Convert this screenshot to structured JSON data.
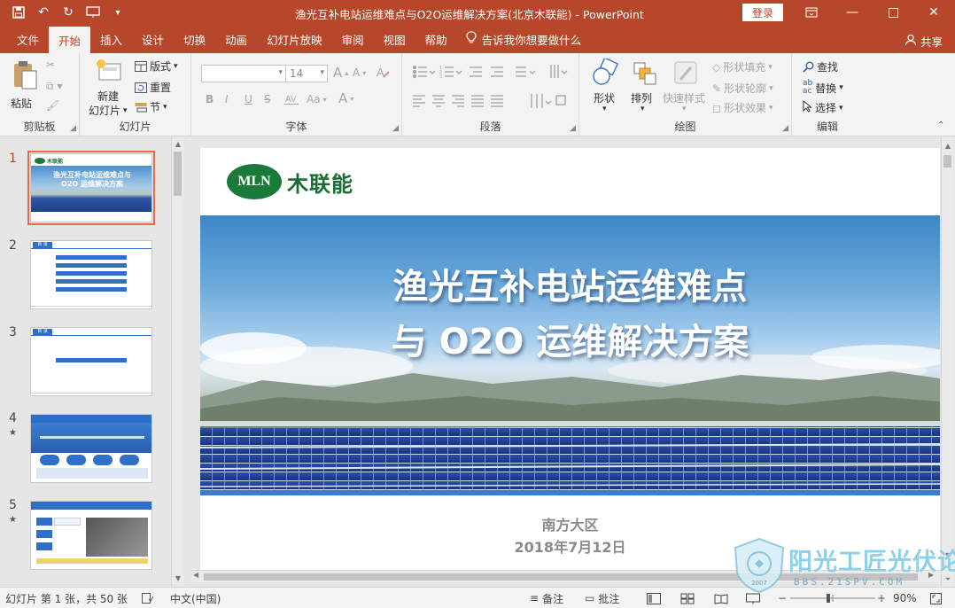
{
  "window": {
    "title": "渔光互补电站运维难点与O2O运维解决方案(北京木联能)  -  PowerPoint",
    "login_label": "登录"
  },
  "tabs": [
    "文件",
    "开始",
    "插入",
    "设计",
    "切换",
    "动画",
    "幻灯片放映",
    "审阅",
    "视图",
    "帮助"
  ],
  "active_tab": "开始",
  "tell_me": "告诉我你想要做什么",
  "share": "共享",
  "ribbon": {
    "clipboard": {
      "label": "剪贴板",
      "paste": "粘贴"
    },
    "slides": {
      "label": "幻灯片",
      "new_slide_1": "新建",
      "new_slide_2": "幻灯片",
      "layout": "版式",
      "reset": "重置",
      "section": "节"
    },
    "font": {
      "label": "字体",
      "font_size": "14",
      "bold": "B",
      "italic": "I",
      "underline": "U",
      "strike": "S",
      "aa": "Aa",
      "a_big": "A",
      "a_small": "A",
      "a_color": "A"
    },
    "paragraph": {
      "label": "段落"
    },
    "drawing": {
      "label": "绘图",
      "shape": "形状",
      "arrange": "排列",
      "quick_styles": "快速样式",
      "shape_fill": "形状填充",
      "shape_outline": "形状轮廓",
      "shape_effects": "形状效果"
    },
    "editing": {
      "label": "编辑",
      "find": "查找",
      "replace": "替换",
      "select": "选择"
    }
  },
  "thumbnails": [
    {
      "number": "1",
      "star": ""
    },
    {
      "number": "2",
      "star": ""
    },
    {
      "number": "3",
      "star": ""
    },
    {
      "number": "4",
      "star": "★"
    },
    {
      "number": "5",
      "star": "★"
    }
  ],
  "thumb_text": {
    "t1_logo": "木联能",
    "t1_title": "渔光互补电站运维难点与 O2O 运维解决方案",
    "t2_head": "目 录",
    "t3_head": "目 录"
  },
  "slide": {
    "logo_mark": "MLN",
    "logo_text": "木联能",
    "title_line1": "渔光互补电站运维难点",
    "title_line2": "与 O2O 运维解决方案",
    "region": "南方大区",
    "date": "2018年7月12日"
  },
  "status": {
    "slide_info": "幻灯片 第 1 张，共 50 张",
    "language": "中文(中国)",
    "notes": "备注",
    "comments": "批注",
    "zoom": "90%"
  },
  "watermark": {
    "text": "阳光工匠光伏论坛",
    "url": "BBS.21SPV.COM",
    "year": "2007"
  },
  "colors": {
    "accent": "#b7472a",
    "logo_green": "#1a7a3a",
    "thumb_blue": "#2f6fc6"
  }
}
